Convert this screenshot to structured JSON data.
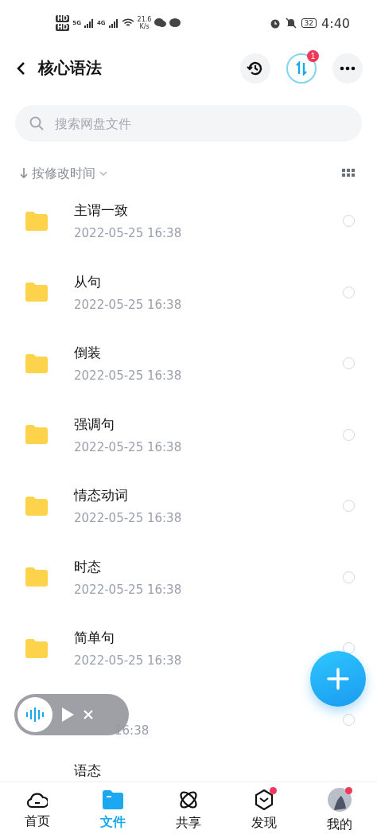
{
  "status_bar": {
    "sim_labels": [
      "HD",
      "HD"
    ],
    "networks": [
      "5G",
      "4G"
    ],
    "speed": "21.6",
    "speed_unit": "K/s",
    "battery": "32",
    "time": "4:40"
  },
  "header": {
    "title": "核心语法",
    "transfer_badge": "1"
  },
  "search": {
    "placeholder": "搜索网盘文件"
  },
  "sort": {
    "label": "按修改时间"
  },
  "files": [
    {
      "kind": "folder",
      "name": "主谓一致",
      "date": "2022-05-25  16:38",
      "selected": false
    },
    {
      "kind": "folder",
      "name": "从句",
      "date": "2022-05-25  16:38",
      "selected": false
    },
    {
      "kind": "folder",
      "name": "倒装",
      "date": "2022-05-25  16:38",
      "selected": false
    },
    {
      "kind": "folder",
      "name": "强调句",
      "date": "2022-05-25  16:38",
      "selected": false
    },
    {
      "kind": "folder",
      "name": "情态动词",
      "date": "2022-05-25  16:38",
      "selected": false
    },
    {
      "kind": "folder",
      "name": "时态",
      "date": "2022-05-25  16:38",
      "selected": false
    },
    {
      "kind": "folder",
      "name": "简单句",
      "date": "2022-05-25  16:38",
      "selected": false
    },
    {
      "kind": "covered",
      "date": "16:38",
      "selected": false
    },
    {
      "kind": "clipped",
      "name": "语态"
    }
  ],
  "tabs": [
    {
      "label": "首页",
      "selected": false,
      "dot": false
    },
    {
      "label": "文件",
      "selected": true,
      "dot": false
    },
    {
      "label": "共享",
      "selected": false,
      "dot": false
    },
    {
      "label": "发现",
      "selected": false,
      "dot": true
    },
    {
      "label": "我的",
      "selected": false,
      "dot": true
    }
  ]
}
